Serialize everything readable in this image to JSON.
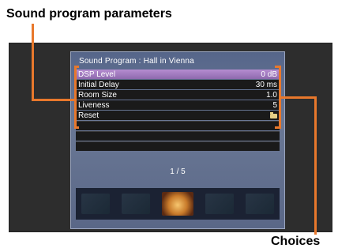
{
  "callouts": {
    "top": "Sound program parameters",
    "bottom": "Choices"
  },
  "osd": {
    "title": "Sound Program : Hall in Vienna",
    "rows": [
      {
        "label": "DSP Level",
        "value": "0 dB",
        "selected": true
      },
      {
        "label": "Initial Delay",
        "value": "30 ms"
      },
      {
        "label": "Room Size",
        "value": "1.0"
      },
      {
        "label": "Liveness",
        "value": "5"
      },
      {
        "label": "Reset",
        "value_icon": "folder-icon"
      }
    ],
    "page": "1 / 5",
    "thumbnails": [
      "hall-thumbnail-1",
      "hall-thumbnail-2",
      "hall-thumbnail-3",
      "hall-thumbnail-4",
      "hall-thumbnail-5"
    ]
  },
  "colors": {
    "callout": "#e8782c",
    "selected_row": "#9b76bd",
    "panel": "#63728f"
  }
}
